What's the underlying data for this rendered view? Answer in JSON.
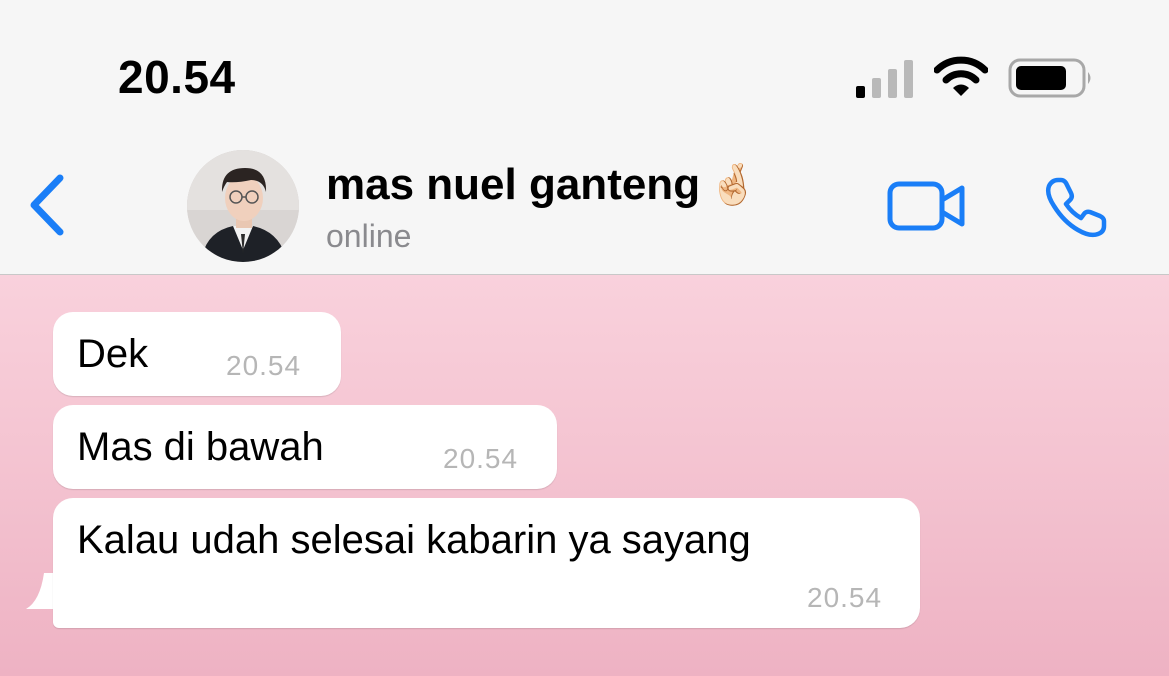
{
  "status_bar": {
    "time": "20.54"
  },
  "header": {
    "contact_name": "mas nuel ganteng",
    "name_emoji": "🤞🏻",
    "presence": "online",
    "icons": {
      "back": "chevron-left-icon",
      "video": "video-camera-icon",
      "call": "phone-icon"
    }
  },
  "colors": {
    "accent": "#1a7ef7",
    "chat_bg_top": "#f9d1dc",
    "chat_bg_bottom": "#eeb2c3",
    "bubble": "#ffffff",
    "timestamp": "#b6b6b6"
  },
  "messages": [
    {
      "text": "Dek",
      "time": "20.54"
    },
    {
      "text": "Mas di bawah",
      "time": "20.54"
    },
    {
      "text": "Kalau udah selesai kabarin ya sayang",
      "time": "20.54"
    }
  ]
}
